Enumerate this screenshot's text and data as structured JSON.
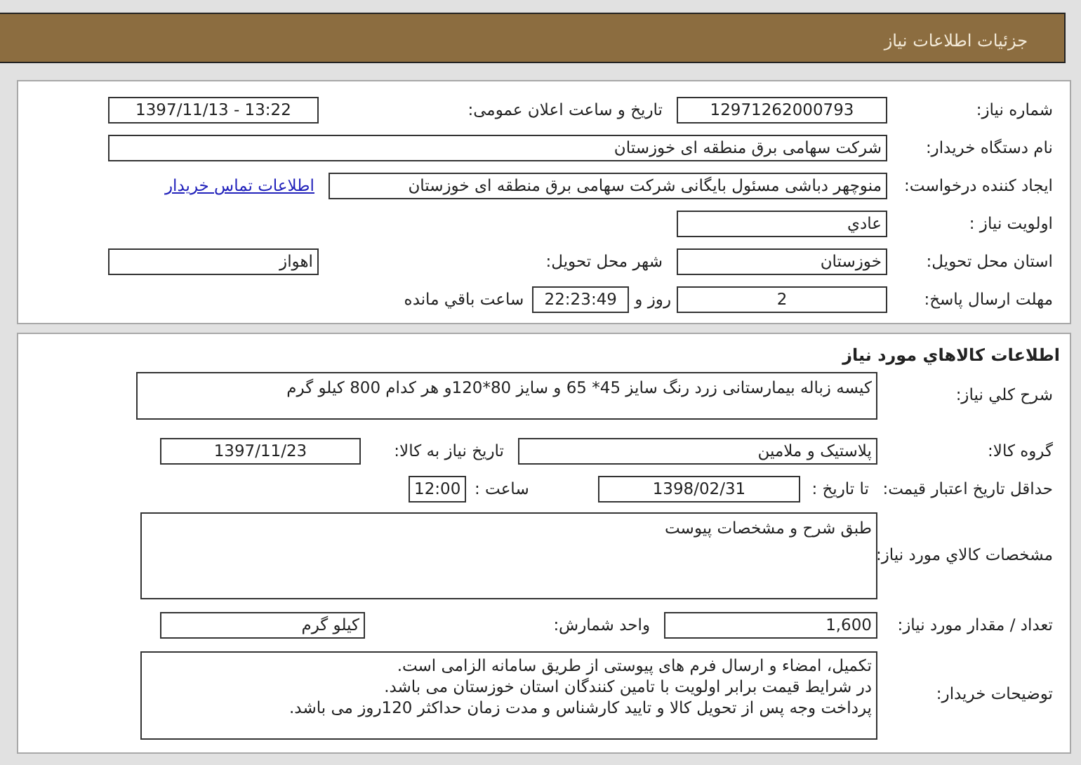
{
  "header": {
    "title": "جزئیات اطلاعات نیاز"
  },
  "summary": {
    "need_number": {
      "label": "شماره نیاز:",
      "value": "12971262000793"
    },
    "announce": {
      "label": "تاریخ و ساعت اعلان عمومی:",
      "value": "1397/11/13 - 13:22"
    },
    "buyer_org": {
      "label": "نام دستگاه خریدار:",
      "value": "شرکت سهامی برق منطقه ای خوزستان"
    },
    "requester": {
      "label": "ایجاد کننده درخواست:",
      "value": "منوچهر دباشی مسئول بایگانی شرکت سهامی برق منطقه ای خوزستان",
      "link": "اطلاعات تماس خریدار"
    },
    "priority": {
      "label": "اولویت نیاز :",
      "value": "عادي"
    },
    "province": {
      "label": "استان محل تحویل:",
      "value": "خوزستان"
    },
    "city": {
      "label": "شهر محل تحویل:",
      "value": "اهواز"
    },
    "deadline": {
      "label": "مهلت ارسال پاسخ:",
      "days": "2",
      "days_text": "روز و",
      "time": "22:23:49",
      "remaining": "ساعت باقي مانده"
    }
  },
  "goods": {
    "title": "اطلاعات کالاهاي مورد نياز",
    "description": {
      "label": "شرح کلي نياز:",
      "value": "کیسه زباله بیمارستانی زرد رنگ سایز 45* 65 و سایز 80*120و هر کدام 800 کیلو گرم"
    },
    "group": {
      "label": "گروه کالا:",
      "value": "پلاستیک و ملامین"
    },
    "need_date": {
      "label": "تاریخ نیاز به کالا:",
      "value": "1397/11/23"
    },
    "price_validity": {
      "label": "حداقل تاریخ اعتبار قیمت:",
      "to_label": "تا تاریخ :",
      "date": "1398/02/31",
      "time_label": "ساعت :",
      "time": "12:00"
    },
    "specs": {
      "label": "مشخصات کالاي مورد نياز:",
      "value": "طبق شرح و مشخصات پیوست"
    },
    "quantity": {
      "label": "تعداد / مقدار مورد نیاز:",
      "value": "1,600"
    },
    "unit": {
      "label": "واحد شمارش:",
      "value": "کیلو گرم"
    },
    "notes": {
      "label": "توضیحات خریدار:",
      "lines": [
        "تکمیل، امضاء و ارسال فرم های پیوستی از طریق سامانه الزامی است.",
        "در شرایط  قیمت برابر اولویت با تامین کنندگان استان خوزستان می باشد.",
        "پرداخت وجه پس از تحویل کالا و تایید کارشناس و مدت زمان حداکثر 120روز می باشد."
      ]
    }
  }
}
